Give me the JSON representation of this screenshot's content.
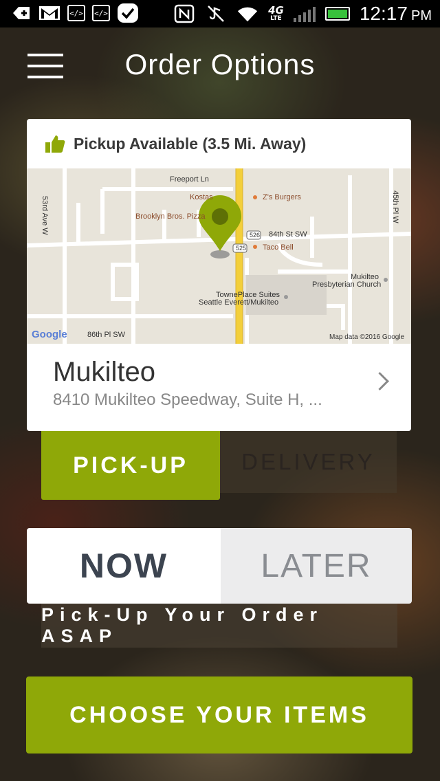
{
  "status_bar": {
    "time": "12:17",
    "ampm": "PM",
    "network": "4G",
    "network_sub": "LTE",
    "icons": [
      "plus-icon",
      "gmail-icon",
      "code-icon",
      "code-icon",
      "check-bubble-icon",
      "nfc-icon",
      "mute-icon",
      "wifi-icon",
      "signal-icon",
      "battery-charging-icon"
    ]
  },
  "header": {
    "menu_icon": "hamburger-menu-icon",
    "title": "Order Options"
  },
  "location_card": {
    "availability_icon": "thumbs-up-icon",
    "availability_text": "Pickup Available (3.5 Mi. Away)",
    "map": {
      "labels": {
        "freeport": "Freeport Ln",
        "kostas": "Kostas",
        "z_burgers": "Z's Burgers",
        "brooklyn": "Brooklyn Bros. Pizza",
        "st84": "84th St SW",
        "taco_bell": "Taco Bell",
        "ave53": "53rd Ave W",
        "pl45": "45th Pl W",
        "mukilteo_church1": "Mukilteo",
        "mukilteo_church2": "Presbyterian Church",
        "towne1": "TownePlace Suites",
        "towne2": "Seattle Everett/Mukilteo",
        "pl86": "86th Pl SW",
        "shield_526": "526",
        "shield_525": "525",
        "google": "Google",
        "map_data": "Map data ©2016 Google"
      },
      "pin_icon": "map-pin-icon"
    },
    "name": "Mukilteo",
    "address": "8410 Mukilteo Speedway, Suite H, ...",
    "chevron_icon": "chevron-right-icon"
  },
  "order_type": {
    "pickup_label": "PICK-UP",
    "delivery_label": "DELIVERY",
    "selected": "PICK-UP"
  },
  "timing": {
    "now_label": "NOW",
    "later_label": "LATER",
    "selected": "NOW",
    "message": "Pick-Up Your Order ASAP"
  },
  "cta": {
    "label": "CHOOSE YOUR ITEMS"
  },
  "colors": {
    "accent": "#8fa808",
    "pin": "#8fa808",
    "road_highway": "#f3cf3b"
  }
}
